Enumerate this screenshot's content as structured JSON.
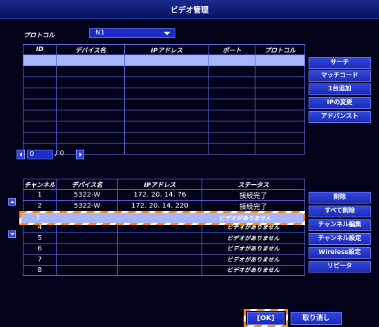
{
  "window": {
    "title": "ビデオ管理"
  },
  "protocol": {
    "label": "プロトコル",
    "value": "N1"
  },
  "device_table": {
    "headers": [
      "ID",
      "デバイス名",
      "IPアドレス",
      "ポート",
      "プロトコル"
    ],
    "row_count": 9
  },
  "device_buttons": [
    "サーチ",
    "マッチコード",
    "1台追加",
    "IPの変更",
    "アドバンスト"
  ],
  "pager": {
    "current": "0",
    "separator": "/ 0"
  },
  "channel_table": {
    "headers": [
      "チャンネル",
      "デバイス名",
      "IPアドレス",
      "ステータス"
    ],
    "rows": [
      {
        "ch": "1",
        "device": "5322-W",
        "ip": "172. 20. 14. 76",
        "status": "接続完了"
      },
      {
        "ch": "2",
        "device": "5322-W",
        "ip": "172. 20. 14. 220",
        "status": "接続完了"
      },
      {
        "ch": "3",
        "device": "",
        "ip": "",
        "status": "ビデオがありません"
      },
      {
        "ch": "4",
        "device": "",
        "ip": "",
        "status": "ビデオがありません"
      },
      {
        "ch": "5",
        "device": "",
        "ip": "",
        "status": "ビデオがありません"
      },
      {
        "ch": "6",
        "device": "",
        "ip": "",
        "status": "ビデオがありません"
      },
      {
        "ch": "7",
        "device": "",
        "ip": "",
        "status": "ビデオがありません"
      },
      {
        "ch": "8",
        "device": "",
        "ip": "",
        "status": "ビデオがありません"
      }
    ]
  },
  "channel_buttons": [
    "削除",
    "すべて削除",
    "チャンネル編集",
    "チャンネル設定",
    "Wireless設定",
    "リピータ"
  ],
  "footer": {
    "ok": "[OK]",
    "cancel": "取り消し"
  },
  "colors": {
    "background": "#02031a",
    "title_bar": "#0e1c7a",
    "button": "#2236c8",
    "selection": "#a7b4ff",
    "highlight": "#ff8a00"
  }
}
